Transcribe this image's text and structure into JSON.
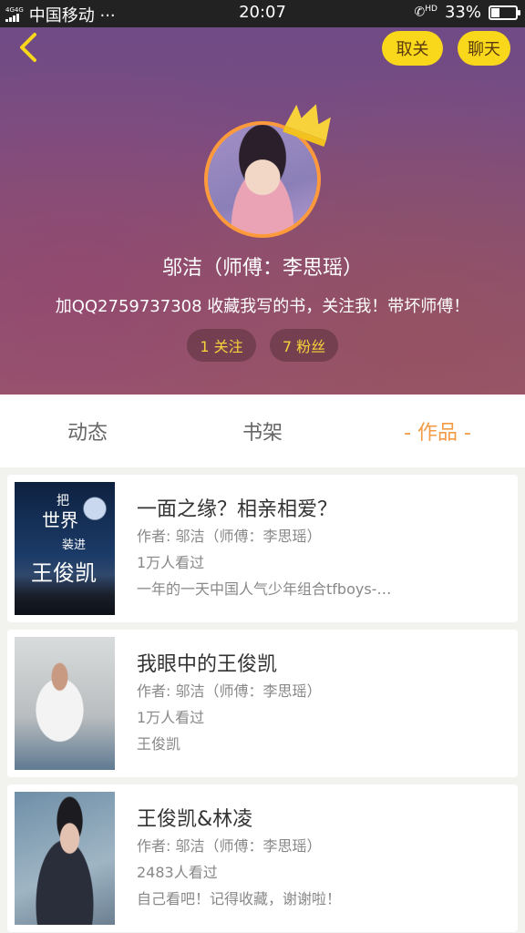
{
  "status_bar": {
    "network": "4G4G",
    "carrier": "中国移动 ···",
    "time": "20:07",
    "call_label": "HD",
    "battery_percent": "33%",
    "battery_level": 0.33
  },
  "header": {
    "unfollow_label": "取关",
    "chat_label": "聊天",
    "username": "邬洁（师傅：李思瑶）",
    "bio": "加QQ2759737308 收藏我写的书，关注我！带坏师傅！",
    "following": "1 关注",
    "fans": "7 粉丝",
    "accent_color": "#f9d71b",
    "avatar_ring_color": "#ff9a3c"
  },
  "tabs": [
    {
      "label": "动态",
      "active": false
    },
    {
      "label": "书架",
      "active": false
    },
    {
      "label": "- 作品 -",
      "active": true
    }
  ],
  "works": [
    {
      "title": "一面之缘？相亲相爱？",
      "author": "作者: 邬洁（师傅：李思瑶）",
      "views": "1万人看过",
      "desc": "一年的一天中国人气少年组合tfboys-…",
      "cover_text": [
        "把",
        "世界",
        "装进",
        "王俊凯"
      ]
    },
    {
      "title": "我眼中的王俊凯",
      "author": "作者: 邬洁（师傅：李思瑶）",
      "views": "1万人看过",
      "desc": "王俊凯"
    },
    {
      "title": "王俊凯&林凌",
      "author": "作者: 邬洁（师傅：李思瑶）",
      "views": "2483人看过",
      "desc": "自己看吧！记得收藏，谢谢啦！"
    }
  ]
}
